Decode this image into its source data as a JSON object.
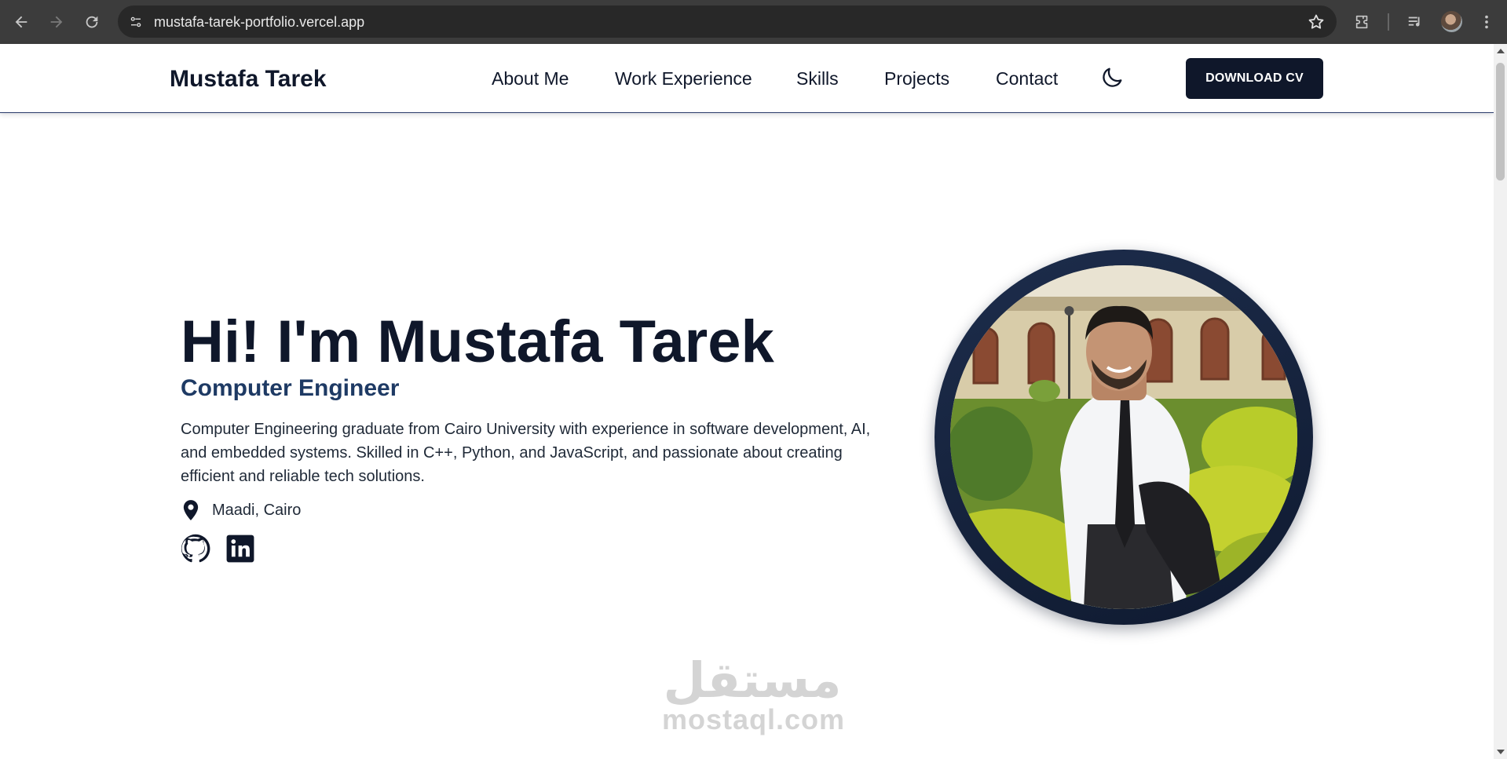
{
  "browser": {
    "url": "mustafa-tarek-portfolio.vercel.app",
    "icons": [
      "back-arrow-icon",
      "forward-arrow-icon",
      "reload-icon",
      "site-settings-icon",
      "bookmark-star-icon",
      "extensions-icon",
      "media-controls-icon",
      "profile-avatar",
      "more-menu-icon"
    ]
  },
  "header": {
    "brand": "Mustafa Tarek",
    "nav": [
      {
        "label": "About Me"
      },
      {
        "label": "Work Experience"
      },
      {
        "label": "Skills"
      },
      {
        "label": "Projects"
      },
      {
        "label": "Contact"
      }
    ],
    "theme_icon": "moon-icon",
    "download_label": "DOWNLOAD CV"
  },
  "hero": {
    "title": "Hi! I'm Mustafa Tarek",
    "subtitle": "Computer Engineer",
    "bio": "Computer Engineering graduate from Cairo University with experience in software development, AI, and embedded systems. Skilled in C++, Python, and JavaScript, and passionate about creating efficient and reliable tech solutions.",
    "location": "Maadi, Cairo",
    "socials": [
      "github-icon",
      "linkedin-icon"
    ]
  },
  "watermark": {
    "arabic": "مستقل",
    "latin": "mostaql.com"
  },
  "colors": {
    "primary": "#0f172a",
    "accent": "#1e3a64",
    "chrome_bg": "#3c3c3c",
    "omnibox_bg": "#282828"
  }
}
